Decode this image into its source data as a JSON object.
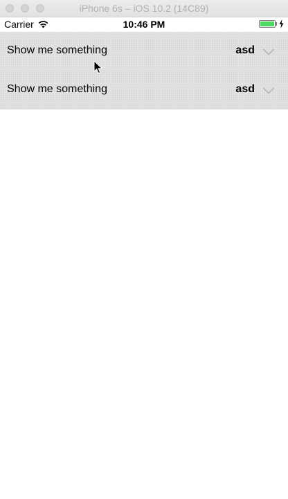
{
  "simulator": {
    "title": "iPhone 6s – iOS 10.2 (14C89)"
  },
  "statusbar": {
    "carrier": "Carrier",
    "time": "10:46 PM",
    "battery_level": 1.0,
    "battery_color": "#4cd964"
  },
  "rows": [
    {
      "title": "Show me something",
      "value": "asd",
      "icon": "chevron-down-icon"
    },
    {
      "title": "Show me something",
      "value": "asd",
      "icon": "chevron-down-icon"
    }
  ],
  "colors": {
    "row_background": "#e1e1e1",
    "chevron": "#b8b8b8"
  }
}
